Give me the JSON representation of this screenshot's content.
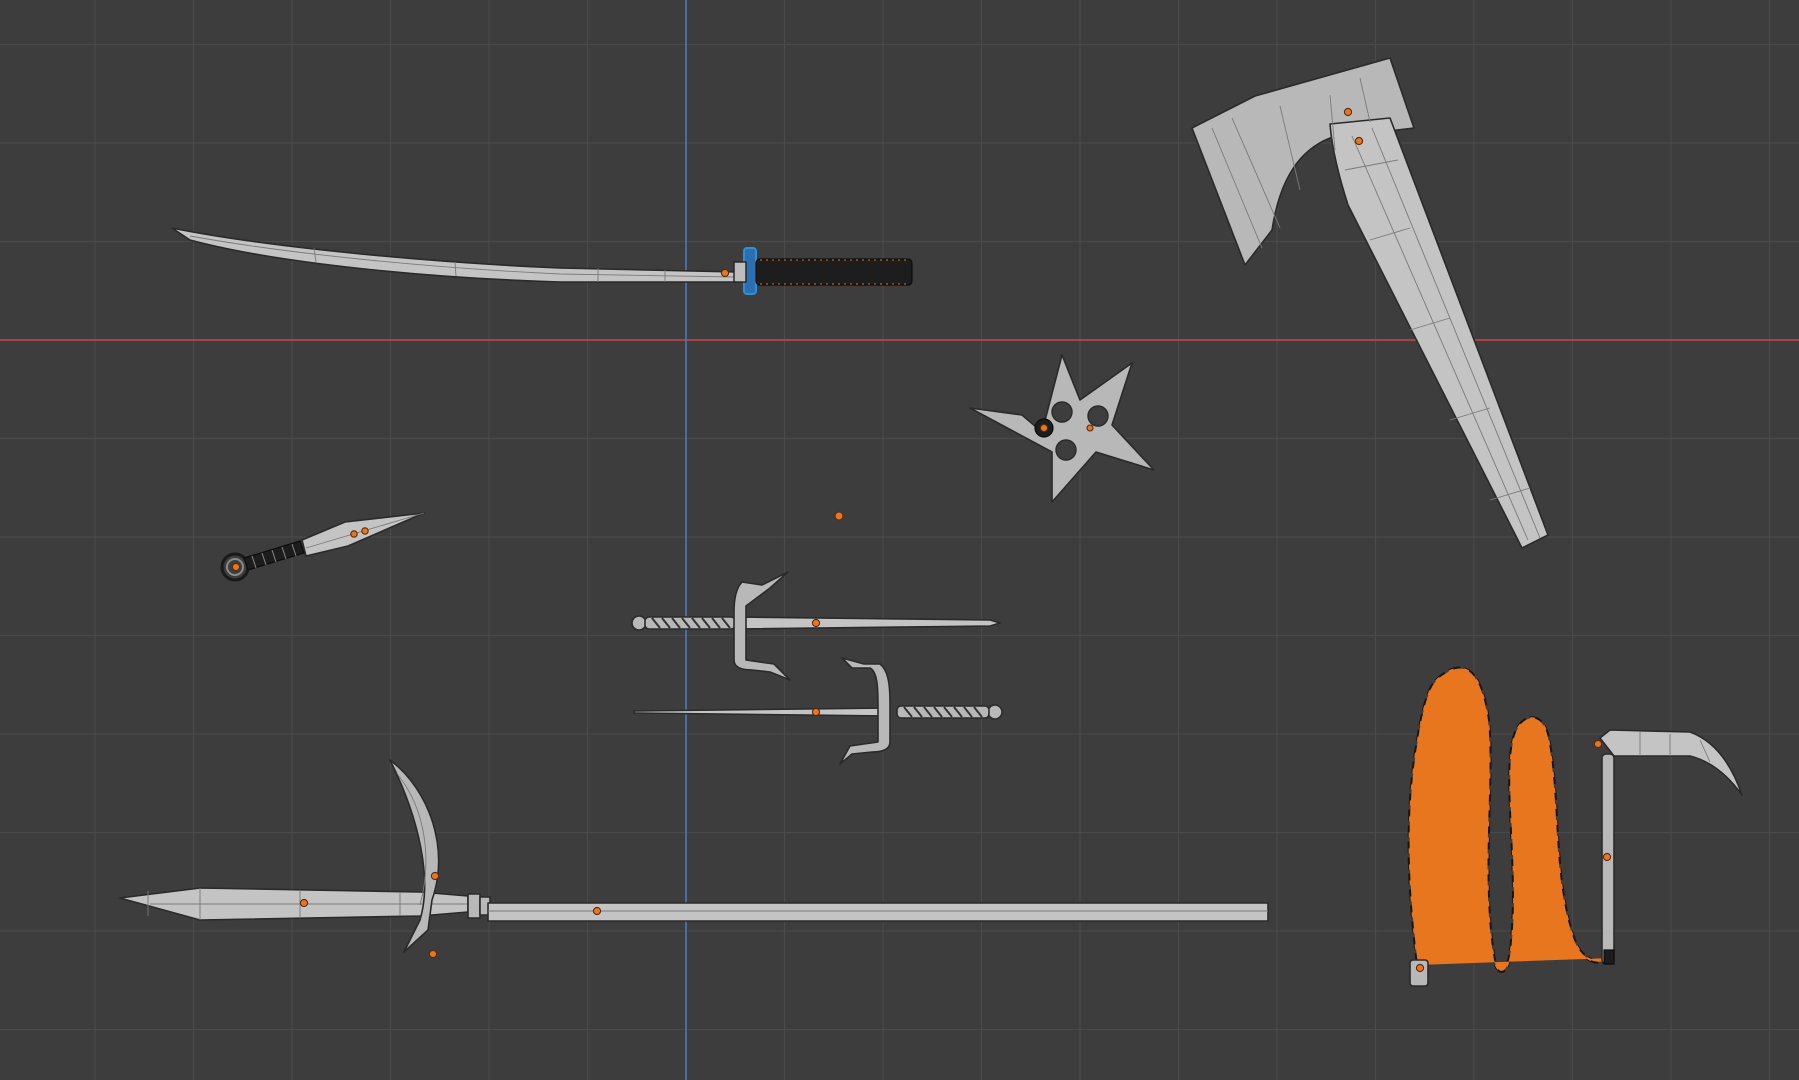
{
  "viewport": {
    "background": "#3d3d3d",
    "grid_minor_color": "#4a4a4a",
    "grid_major_color": "#505050",
    "x_axis_color": "#c8474f",
    "y_axis_color": "#4a78c2",
    "origin_color": "#e8761f",
    "selection_color": "#2f8fd8"
  },
  "objects": [
    {
      "id": "katana",
      "icon": "katana-mesh"
    },
    {
      "id": "axe",
      "icon": "axe-mesh"
    },
    {
      "id": "shuriken",
      "icon": "shuriken-mesh"
    },
    {
      "id": "kunai",
      "icon": "kunai-mesh"
    },
    {
      "id": "sai-top",
      "icon": "sai-mesh"
    },
    {
      "id": "sai-bottom",
      "icon": "sai-mesh"
    },
    {
      "id": "spear",
      "icon": "spear-mesh"
    },
    {
      "id": "kusarigama",
      "icon": "kusarigama-mesh"
    }
  ]
}
